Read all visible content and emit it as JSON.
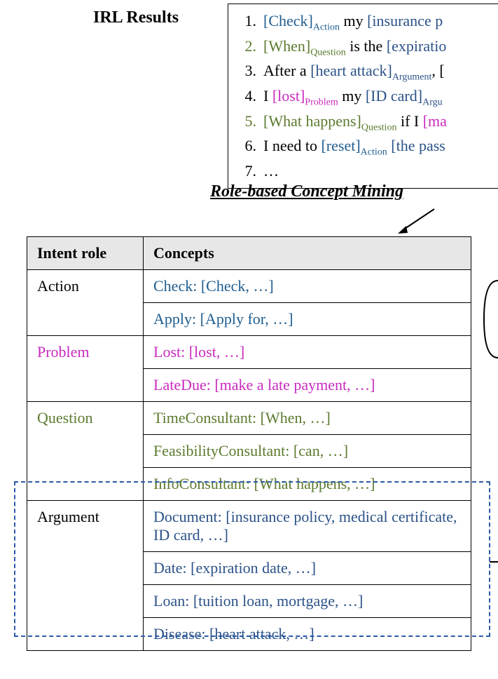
{
  "irl_title": "IRL Results",
  "section_title": "Role-based Concept Mining",
  "colors": {
    "action": "#1f5d8f",
    "problem": "#c92abf",
    "question": "#5b7a2e",
    "argument": "#2b5288"
  },
  "irl_items": {
    "i1": {
      "num": "1.",
      "num_class": "c-black",
      "parts": [
        {
          "text": "[Check]",
          "class": "c-action"
        },
        {
          "text": "Action",
          "class": "c-action sub"
        },
        {
          "text": " my ",
          "class": "c-black"
        },
        {
          "text": "[insurance p",
          "class": "c-argument"
        }
      ]
    },
    "i2": {
      "num": "2.",
      "num_class": "c-question",
      "parts": [
        {
          "text": "[When]",
          "class": "c-question"
        },
        {
          "text": "Question",
          "class": "c-question sub"
        },
        {
          "text": " is the ",
          "class": "c-black"
        },
        {
          "text": "[expiratio",
          "class": "c-argument"
        }
      ]
    },
    "i3": {
      "num": "3.",
      "num_class": "c-black",
      "parts": [
        {
          "text": "After a ",
          "class": "c-black"
        },
        {
          "text": "[heart attack]",
          "class": "c-argument"
        },
        {
          "text": "Argument",
          "class": "c-argument sub"
        },
        {
          "text": ", ",
          "class": "c-black"
        },
        {
          "text": "[",
          "class": "c-black"
        }
      ]
    },
    "i4": {
      "num": "4.",
      "num_class": "c-black",
      "parts": [
        {
          "text": "I ",
          "class": "c-black"
        },
        {
          "text": "[lost]",
          "class": "c-problem"
        },
        {
          "text": "Problem",
          "class": "c-problem sub"
        },
        {
          "text": " my ",
          "class": "c-black"
        },
        {
          "text": "[ID card]",
          "class": "c-argument"
        },
        {
          "text": "Argu",
          "class": "c-argument sub"
        }
      ]
    },
    "i5": {
      "num": "5.",
      "num_class": "c-question",
      "parts": [
        {
          "text": "[What happens]",
          "class": "c-question"
        },
        {
          "text": "Question",
          "class": "c-question sub"
        },
        {
          "text": " if I ",
          "class": "c-black"
        },
        {
          "text": "[ma",
          "class": "c-problem"
        }
      ]
    },
    "i6": {
      "num": "6.",
      "num_class": "c-black",
      "parts": [
        {
          "text": "I need to ",
          "class": "c-black"
        },
        {
          "text": "[reset]",
          "class": "c-action"
        },
        {
          "text": "Action",
          "class": "c-action sub"
        },
        {
          "text": " ",
          "class": "c-black"
        },
        {
          "text": "[the pass",
          "class": "c-argument"
        }
      ]
    },
    "i7": {
      "num": "7.",
      "num_class": "c-black",
      "parts": [
        {
          "text": "…",
          "class": "c-black"
        }
      ]
    }
  },
  "table": {
    "header_role": "Intent role",
    "header_concepts": "Concepts",
    "rows": {
      "action": {
        "label": "Action",
        "label_class": "c-black",
        "cells": [
          "Check: [Check, …]",
          "Apply: [Apply for, …]"
        ],
        "cell_class": "c-action"
      },
      "problem": {
        "label": "Problem",
        "label_class": "c-problem",
        "cells": [
          "Lost: [lost, …]",
          "LateDue: [make a late payment, …]"
        ],
        "cell_class": "c-problem"
      },
      "question": {
        "label": "Question",
        "label_class": "c-question",
        "cells": [
          "TimeConsultant: [When, …]",
          "FeasibilityConsultant: [can, …]",
          "InfoConsultant: [What happens, …]"
        ],
        "cell_class": "c-question"
      },
      "argument": {
        "label": "Argument",
        "label_class": "c-black",
        "cells": [
          "Document: [insurance policy, medical certificate, ID card, …]",
          "Date: [expiration date, …]",
          "Loan: [tuition loan, mortgage, …]",
          "Disease: [heart attack, …]"
        ],
        "cell_class": "c-argument"
      }
    }
  }
}
